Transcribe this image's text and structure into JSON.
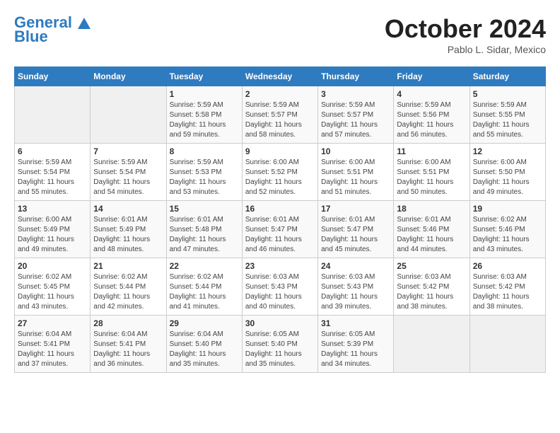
{
  "header": {
    "logo_line1": "General",
    "logo_line2": "Blue",
    "month_title": "October 2024",
    "location": "Pablo L. Sidar, Mexico"
  },
  "weekdays": [
    "Sunday",
    "Monday",
    "Tuesday",
    "Wednesday",
    "Thursday",
    "Friday",
    "Saturday"
  ],
  "weeks": [
    [
      {
        "day": "",
        "sunrise": "",
        "sunset": "",
        "daylight": ""
      },
      {
        "day": "",
        "sunrise": "",
        "sunset": "",
        "daylight": ""
      },
      {
        "day": "1",
        "sunrise": "Sunrise: 5:59 AM",
        "sunset": "Sunset: 5:58 PM",
        "daylight": "Daylight: 11 hours and 59 minutes."
      },
      {
        "day": "2",
        "sunrise": "Sunrise: 5:59 AM",
        "sunset": "Sunset: 5:57 PM",
        "daylight": "Daylight: 11 hours and 58 minutes."
      },
      {
        "day": "3",
        "sunrise": "Sunrise: 5:59 AM",
        "sunset": "Sunset: 5:57 PM",
        "daylight": "Daylight: 11 hours and 57 minutes."
      },
      {
        "day": "4",
        "sunrise": "Sunrise: 5:59 AM",
        "sunset": "Sunset: 5:56 PM",
        "daylight": "Daylight: 11 hours and 56 minutes."
      },
      {
        "day": "5",
        "sunrise": "Sunrise: 5:59 AM",
        "sunset": "Sunset: 5:55 PM",
        "daylight": "Daylight: 11 hours and 55 minutes."
      }
    ],
    [
      {
        "day": "6",
        "sunrise": "Sunrise: 5:59 AM",
        "sunset": "Sunset: 5:54 PM",
        "daylight": "Daylight: 11 hours and 55 minutes."
      },
      {
        "day": "7",
        "sunrise": "Sunrise: 5:59 AM",
        "sunset": "Sunset: 5:54 PM",
        "daylight": "Daylight: 11 hours and 54 minutes."
      },
      {
        "day": "8",
        "sunrise": "Sunrise: 5:59 AM",
        "sunset": "Sunset: 5:53 PM",
        "daylight": "Daylight: 11 hours and 53 minutes."
      },
      {
        "day": "9",
        "sunrise": "Sunrise: 6:00 AM",
        "sunset": "Sunset: 5:52 PM",
        "daylight": "Daylight: 11 hours and 52 minutes."
      },
      {
        "day": "10",
        "sunrise": "Sunrise: 6:00 AM",
        "sunset": "Sunset: 5:51 PM",
        "daylight": "Daylight: 11 hours and 51 minutes."
      },
      {
        "day": "11",
        "sunrise": "Sunrise: 6:00 AM",
        "sunset": "Sunset: 5:51 PM",
        "daylight": "Daylight: 11 hours and 50 minutes."
      },
      {
        "day": "12",
        "sunrise": "Sunrise: 6:00 AM",
        "sunset": "Sunset: 5:50 PM",
        "daylight": "Daylight: 11 hours and 49 minutes."
      }
    ],
    [
      {
        "day": "13",
        "sunrise": "Sunrise: 6:00 AM",
        "sunset": "Sunset: 5:49 PM",
        "daylight": "Daylight: 11 hours and 49 minutes."
      },
      {
        "day": "14",
        "sunrise": "Sunrise: 6:01 AM",
        "sunset": "Sunset: 5:49 PM",
        "daylight": "Daylight: 11 hours and 48 minutes."
      },
      {
        "day": "15",
        "sunrise": "Sunrise: 6:01 AM",
        "sunset": "Sunset: 5:48 PM",
        "daylight": "Daylight: 11 hours and 47 minutes."
      },
      {
        "day": "16",
        "sunrise": "Sunrise: 6:01 AM",
        "sunset": "Sunset: 5:47 PM",
        "daylight": "Daylight: 11 hours and 46 minutes."
      },
      {
        "day": "17",
        "sunrise": "Sunrise: 6:01 AM",
        "sunset": "Sunset: 5:47 PM",
        "daylight": "Daylight: 11 hours and 45 minutes."
      },
      {
        "day": "18",
        "sunrise": "Sunrise: 6:01 AM",
        "sunset": "Sunset: 5:46 PM",
        "daylight": "Daylight: 11 hours and 44 minutes."
      },
      {
        "day": "19",
        "sunrise": "Sunrise: 6:02 AM",
        "sunset": "Sunset: 5:46 PM",
        "daylight": "Daylight: 11 hours and 43 minutes."
      }
    ],
    [
      {
        "day": "20",
        "sunrise": "Sunrise: 6:02 AM",
        "sunset": "Sunset: 5:45 PM",
        "daylight": "Daylight: 11 hours and 43 minutes."
      },
      {
        "day": "21",
        "sunrise": "Sunrise: 6:02 AM",
        "sunset": "Sunset: 5:44 PM",
        "daylight": "Daylight: 11 hours and 42 minutes."
      },
      {
        "day": "22",
        "sunrise": "Sunrise: 6:02 AM",
        "sunset": "Sunset: 5:44 PM",
        "daylight": "Daylight: 11 hours and 41 minutes."
      },
      {
        "day": "23",
        "sunrise": "Sunrise: 6:03 AM",
        "sunset": "Sunset: 5:43 PM",
        "daylight": "Daylight: 11 hours and 40 minutes."
      },
      {
        "day": "24",
        "sunrise": "Sunrise: 6:03 AM",
        "sunset": "Sunset: 5:43 PM",
        "daylight": "Daylight: 11 hours and 39 minutes."
      },
      {
        "day": "25",
        "sunrise": "Sunrise: 6:03 AM",
        "sunset": "Sunset: 5:42 PM",
        "daylight": "Daylight: 11 hours and 38 minutes."
      },
      {
        "day": "26",
        "sunrise": "Sunrise: 6:03 AM",
        "sunset": "Sunset: 5:42 PM",
        "daylight": "Daylight: 11 hours and 38 minutes."
      }
    ],
    [
      {
        "day": "27",
        "sunrise": "Sunrise: 6:04 AM",
        "sunset": "Sunset: 5:41 PM",
        "daylight": "Daylight: 11 hours and 37 minutes."
      },
      {
        "day": "28",
        "sunrise": "Sunrise: 6:04 AM",
        "sunset": "Sunset: 5:41 PM",
        "daylight": "Daylight: 11 hours and 36 minutes."
      },
      {
        "day": "29",
        "sunrise": "Sunrise: 6:04 AM",
        "sunset": "Sunset: 5:40 PM",
        "daylight": "Daylight: 11 hours and 35 minutes."
      },
      {
        "day": "30",
        "sunrise": "Sunrise: 6:05 AM",
        "sunset": "Sunset: 5:40 PM",
        "daylight": "Daylight: 11 hours and 35 minutes."
      },
      {
        "day": "31",
        "sunrise": "Sunrise: 6:05 AM",
        "sunset": "Sunset: 5:39 PM",
        "daylight": "Daylight: 11 hours and 34 minutes."
      },
      {
        "day": "",
        "sunrise": "",
        "sunset": "",
        "daylight": ""
      },
      {
        "day": "",
        "sunrise": "",
        "sunset": "",
        "daylight": ""
      }
    ]
  ]
}
